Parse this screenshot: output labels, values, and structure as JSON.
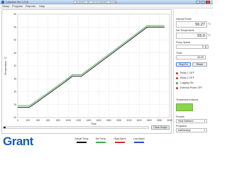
{
  "window": {
    "title": "Labwise Ver 1.0.8",
    "search_text": "Regulation_Bio_ImmunoStabilizer_Test.lbw",
    "controls": [
      "–",
      "□",
      "×"
    ]
  },
  "menu": [
    "Setup",
    "Program",
    "Reports",
    "Help"
  ],
  "chart_data": {
    "type": "line",
    "xlabel": "Time",
    "ylabel": "Temperature, °C",
    "xlim": [
      0,
      3000
    ],
    "ylim": [
      20,
      60
    ],
    "xticks": [
      0,
      200,
      400,
      600,
      800,
      1000,
      1200,
      1400,
      1600,
      1800,
      2000,
      2200,
      2400,
      2600,
      2800,
      3000
    ],
    "yticks": [
      20,
      25,
      30,
      35,
      40,
      45,
      50,
      55,
      60
    ],
    "grid": true,
    "series": [
      {
        "name": "Actual Temp",
        "color": "#111111",
        "x": [
          0,
          230,
          380,
          950,
          1080,
          1260,
          2560,
          2900
        ],
        "y": [
          24,
          24,
          26,
          34,
          36,
          36,
          55,
          55
        ]
      },
      {
        "name": "Set Temp",
        "color": "#4aa84a",
        "x": [
          0,
          230,
          380,
          950,
          1080,
          1260,
          2560,
          2900
        ],
        "y": [
          24.6,
          24.6,
          26.6,
          34.6,
          36.6,
          36.6,
          55.6,
          55.6
        ]
      },
      {
        "name": "High Alarm",
        "color": "#d22d2d",
        "x": [],
        "y": []
      },
      {
        "name": "Low Alarm",
        "color": "#2d4ad2",
        "x": [],
        "y": []
      }
    ]
  },
  "controls": {
    "clear_graph": "Clear Graph"
  },
  "right_panel": {
    "internal_probe_label": "Internal Probe",
    "internal_probe_value": "56.27",
    "internal_probe_unit": "°C",
    "set_temp_label": "Set Temperature",
    "set_temp_value": "55.0",
    "set_temp_unit": "°C",
    "pump_speed_label": "Pump Speed",
    "pump_speed_value": "5",
    "timer_label": "Timer",
    "timer_value": "00:00",
    "start_label": "Stop/Go",
    "reset_label": "Reset",
    "relay1": "Relay 1 OFF",
    "relay2": "Relay 2 OFF",
    "logging": "Logging ON",
    "external_probe": "External Probe OFF",
    "temp_alarms_label": "Temperature Alarms",
    "presets_label": "Presets",
    "presets_value": "Heat Bathend",
    "programs_label": "Programs",
    "programs_value": "bathheatup",
    "alarm_color": "#8bd54a",
    "status_colors": {
      "relay1": "#d22d2d",
      "relay2": "#d22d2d",
      "logging": "#3aa83a",
      "external": "#d22d2d"
    }
  },
  "brand": {
    "logo_text": "Grant",
    "color": "#1a5bb8"
  },
  "legend": [
    {
      "label": "Actual Temp",
      "color": "#111111"
    },
    {
      "label": "Set Temp",
      "color": "#4aa84a"
    },
    {
      "label": "High Alarm",
      "color": "#d22d2d"
    },
    {
      "label": "Low Alarm",
      "color": "#2d4ad2"
    }
  ]
}
